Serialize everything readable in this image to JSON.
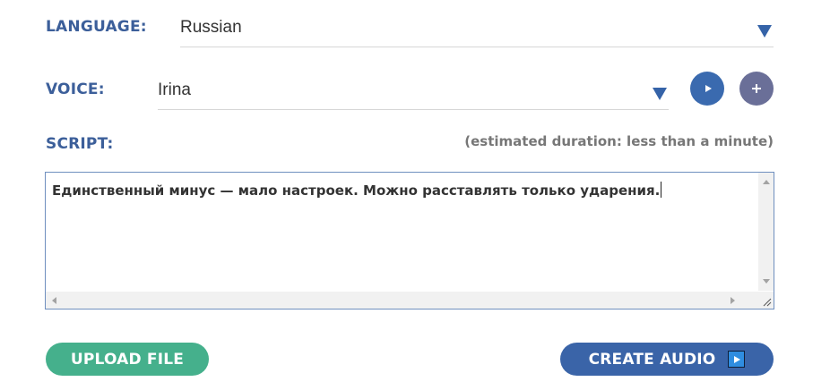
{
  "language": {
    "label": "LANGUAGE:",
    "value": "Russian"
  },
  "voice": {
    "label": "VOICE:",
    "value": "Irina"
  },
  "script": {
    "label": "SCRIPT:",
    "duration": "(estimated duration: less than a minute)",
    "text": "Единственный минус — мало настроек. Можно расставлять только ударения."
  },
  "buttons": {
    "upload": "UPLOAD FILE",
    "create": "CREATE AUDIO"
  },
  "icons": {
    "language_dropdown": "chevron-down-icon",
    "voice_dropdown": "chevron-down-icon",
    "play_voice": "play-icon",
    "add_voice": "plus-icon",
    "create_audio": "play-icon"
  },
  "colors": {
    "label": "#3c5f9a",
    "accent_blue": "#3a64a8",
    "green": "#45b08c",
    "purple_gray": "#6a6f98"
  }
}
